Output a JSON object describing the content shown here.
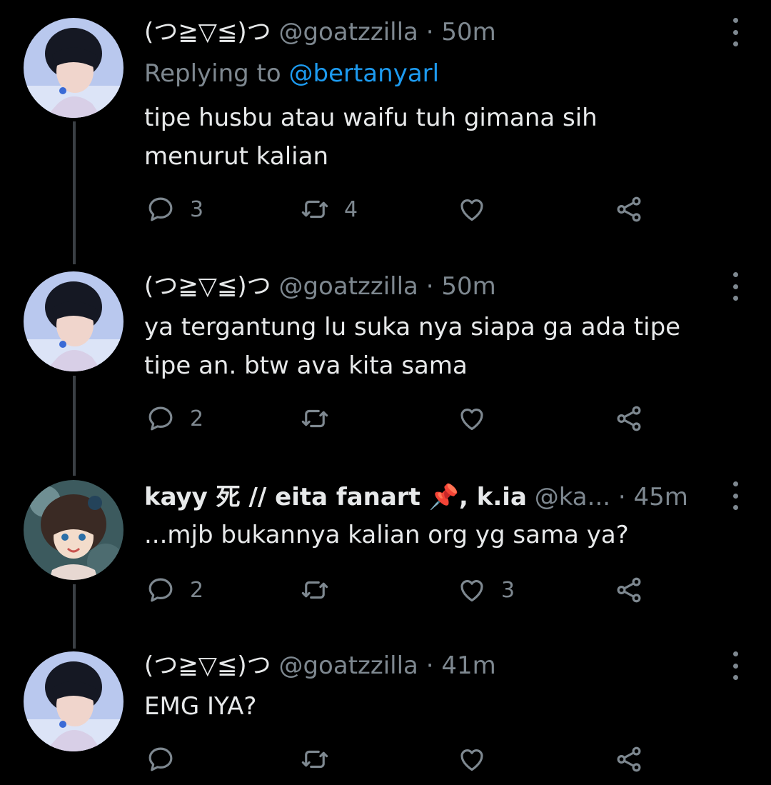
{
  "tweets": [
    {
      "display_name": "(つ≧▽≦)つ",
      "handle": "@goatzzilla",
      "dot": "·",
      "time": "50m",
      "reply_prefix": "Replying to",
      "reply_to": "@bertanyarl",
      "text_lines": [
        "tipe husbu atau waifu tuh gimana sih",
        "menurut kalian"
      ],
      "reply_count": "3",
      "retweet_count": "4",
      "like_count": ""
    },
    {
      "display_name": "(つ≧▽≦)つ",
      "handle": "@goatzzilla",
      "dot": "·",
      "time": "50m",
      "text_lines": [
        "ya tergantung lu suka nya siapa ga ada tipe",
        "tipe an. btw ava kita sama"
      ],
      "reply_count": "2",
      "retweet_count": "",
      "like_count": ""
    },
    {
      "display_name": "kayy 死 // eita fanart 📌, k.ia",
      "handle": "@ka...",
      "dot": "·",
      "time": "45m",
      "text_lines": [
        "...mjb bukannya kalian org yg sama ya?"
      ],
      "reply_count": "2",
      "retweet_count": "",
      "like_count": "3"
    },
    {
      "display_name": "(つ≧▽≦)つ",
      "handle": "@goatzzilla",
      "dot": "·",
      "time": "41m",
      "text_lines": [
        "EMG IYA?"
      ],
      "reply_count": "",
      "retweet_count": "",
      "like_count": ""
    }
  ],
  "icons": {
    "reply": "speech-bubble-icon",
    "retweet": "retweet-icon",
    "like": "heart-icon",
    "share": "share-icon",
    "more": "vertical-dots-icon"
  },
  "colors": {
    "background": "#000000",
    "text": "#e7e9ea",
    "muted": "#7e8890",
    "mention": "#1d9bf0",
    "thread_line": "#3a3f44"
  }
}
